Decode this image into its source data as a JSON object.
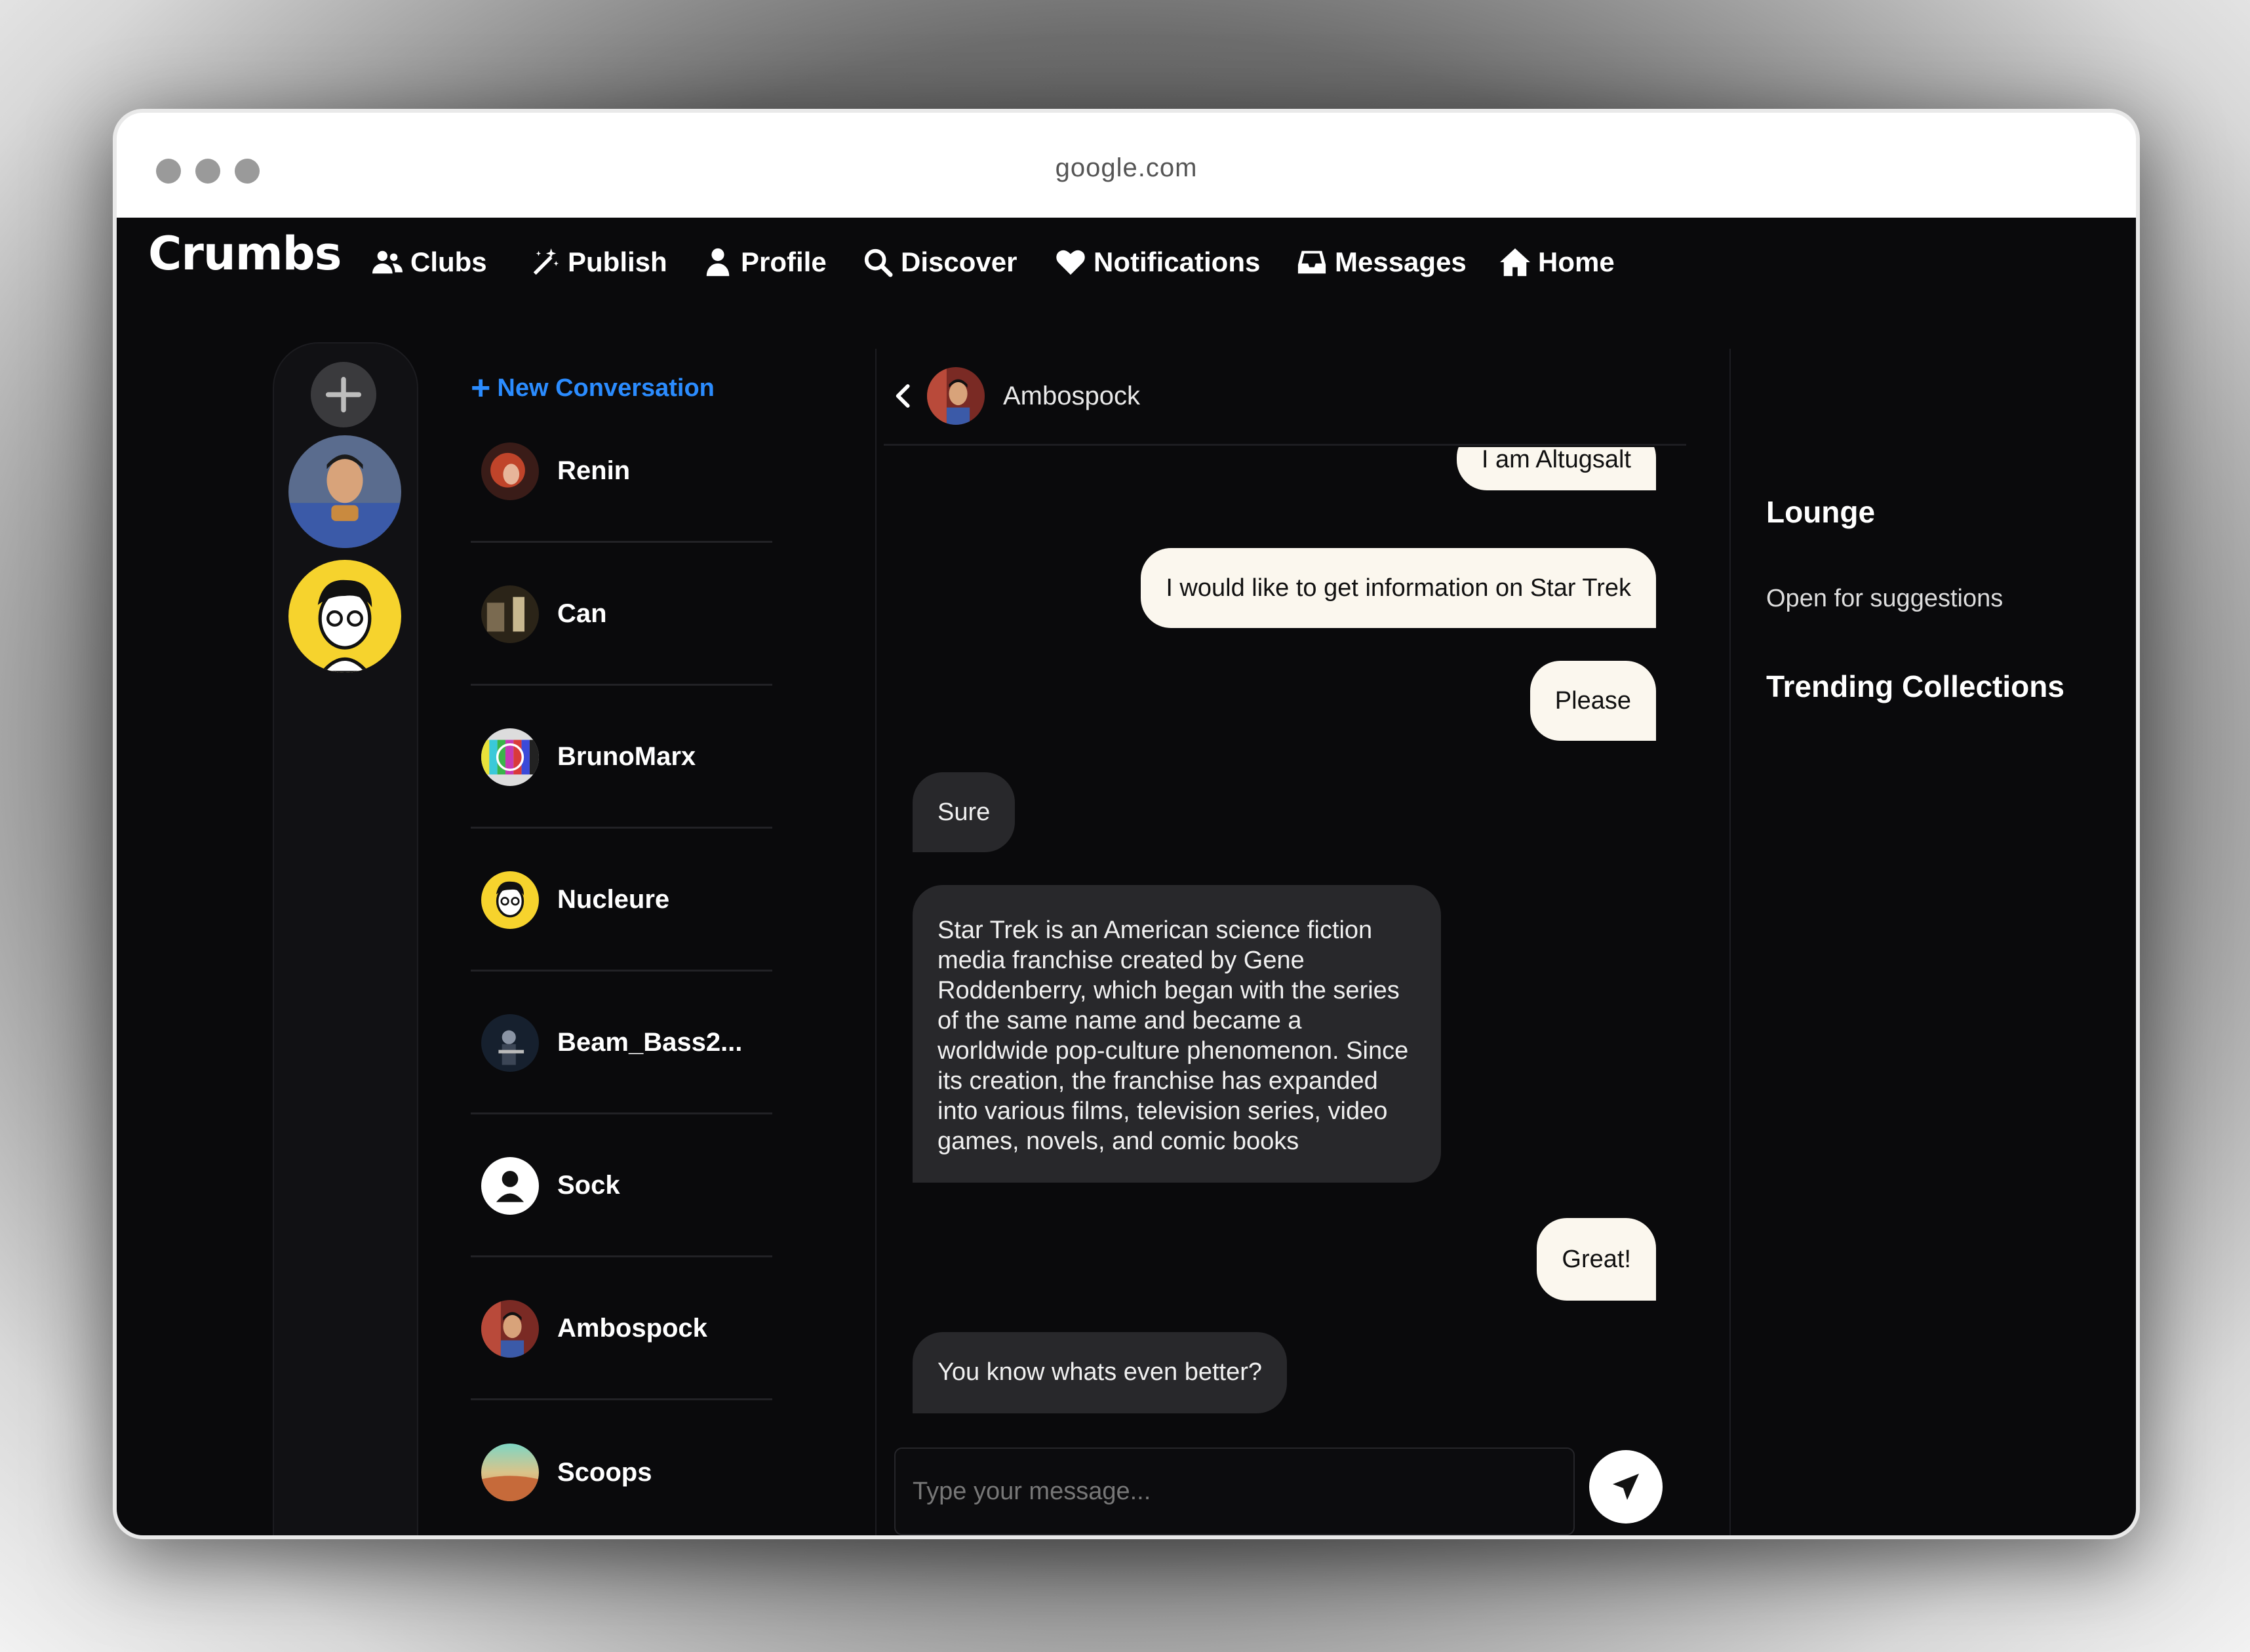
{
  "browser": {
    "url": "google.com"
  },
  "nav": {
    "logo": "Crumbs",
    "items": [
      {
        "label": "Clubs",
        "icon": "users-icon"
      },
      {
        "label": "Publish",
        "icon": "magic-wand-icon"
      },
      {
        "label": "Profile",
        "icon": "user-icon"
      },
      {
        "label": "Discover",
        "icon": "search-icon"
      },
      {
        "label": "Notifications",
        "icon": "heart-icon"
      },
      {
        "label": "Messages",
        "icon": "inbox-icon"
      },
      {
        "label": "Home",
        "icon": "home-icon"
      }
    ]
  },
  "rail": {
    "add_icon": "plus-icon"
  },
  "conversations": {
    "new_label": "New Conversation",
    "items": [
      {
        "name": "Renin"
      },
      {
        "name": "Can"
      },
      {
        "name": "BrunoMarx"
      },
      {
        "name": "Nucleure"
      },
      {
        "name": "Beam_Bass2..."
      },
      {
        "name": "Sock"
      },
      {
        "name": "Ambospock"
      },
      {
        "name": "Scoops"
      }
    ]
  },
  "chat": {
    "name": "Ambospock",
    "messages": [
      {
        "text": "I am Altugsalt",
        "dir": "out"
      },
      {
        "text": "I would like to get information on Star Trek",
        "dir": "out"
      },
      {
        "text": "Please",
        "dir": "out"
      },
      {
        "text": "Sure",
        "dir": "in"
      },
      {
        "text": "Star Trek is an American science fiction media franchise created by Gene Roddenberry, which began with the series of the same name and became a worldwide pop-culture phenomenon. Since its creation, the franchise has expanded into various films, television series, video games, novels, and comic books",
        "dir": "in"
      },
      {
        "text": "Great!",
        "dir": "out"
      },
      {
        "text": "You know whats even better?",
        "dir": "in"
      }
    ],
    "input_placeholder": "Type your message..."
  },
  "sidebar": {
    "lounge_title": "Lounge",
    "lounge_sub": "Open for suggestions",
    "trending_title": "Trending Collections"
  }
}
